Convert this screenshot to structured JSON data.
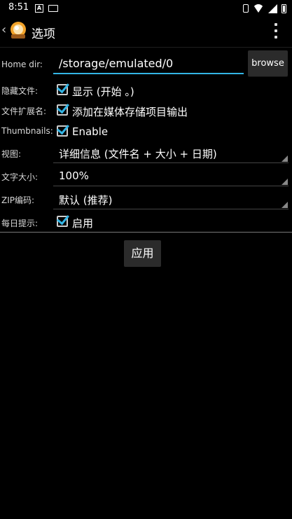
{
  "statusbar": {
    "time": "8:51",
    "notif_a": "A"
  },
  "actionbar": {
    "back_glyph": "‹",
    "title": "选项"
  },
  "settings": {
    "home_dir": {
      "label": "Home dir:",
      "value": "/storage/emulated/0",
      "button": "browse"
    },
    "hidden_files": {
      "label": "隐藏文件:",
      "text": "显示 (开始 。)",
      "checked": true
    },
    "file_ext": {
      "label": "文件扩展名:",
      "text": "添加在媒体存储项目输出",
      "checked": true
    },
    "thumbnails": {
      "label": "Thumbnails:",
      "text": "Enable",
      "checked": true
    },
    "view": {
      "label": "视图:",
      "value": "详细信息 (文件名 + 大小 + 日期)"
    },
    "text_size": {
      "label": "文字大小:",
      "value": "100%"
    },
    "zip_encoding": {
      "label": "ZIP编码:",
      "value": "默认 (推荐)"
    },
    "daily_tip": {
      "label": "每日提示:",
      "text": "启用",
      "checked": true
    }
  },
  "apply_button": "应用",
  "colors": {
    "accent": "#33b5e5",
    "background": "#000000",
    "button": "#2b2b2b"
  }
}
